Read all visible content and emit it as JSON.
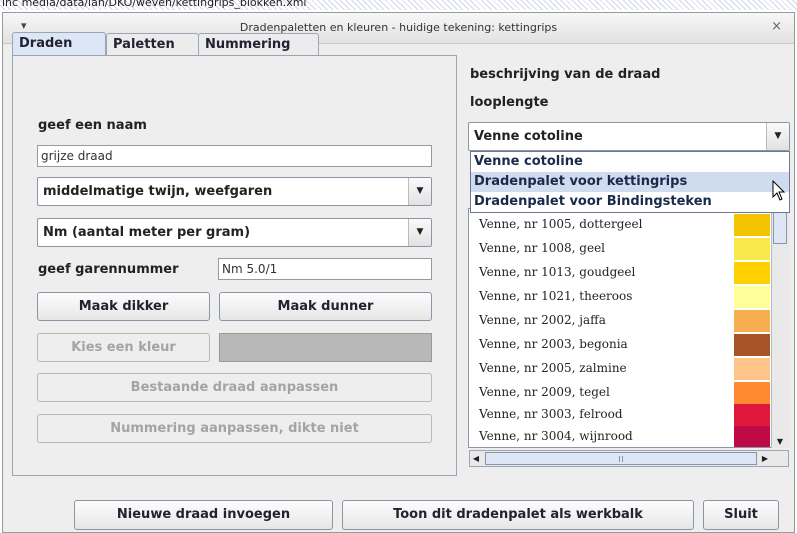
{
  "background_path": "inc   media/data/lan/DKO/weven/kettingrips_blokken.xml",
  "window": {
    "title": "Dradenpaletten en kleuren - huidige tekening: kettingrips",
    "menu_glyph": "▾",
    "close_glyph": "×"
  },
  "tabs": [
    {
      "label": "Draden"
    },
    {
      "label": "Paletten"
    },
    {
      "label": "Nummering"
    }
  ],
  "left": {
    "name_label": "geef een naam",
    "name_value": "grijze draad",
    "type_combo": "middelmatige twijn, weefgaren",
    "unit_combo": "Nm (aantal meter per gram)",
    "count_label": "geef garennummer",
    "count_value": "Nm 5.0/1",
    "thicker_btn": "Maak dikker",
    "thinner_btn": "Maak dunner",
    "color_btn": "Kies een kleur",
    "modify_btn": "Bestaande draad aanpassen",
    "renumber_btn": "Nummering aanpassen, dikte niet"
  },
  "right": {
    "description_label": "beschrijving van de draad",
    "length_label": "looplengte",
    "palette_combo": "Venne cotoline",
    "dropdown_options": [
      {
        "label": "Venne cotoline"
      },
      {
        "label": "Dradenpalet voor kettingrips"
      },
      {
        "label": "Dradenpalet voor Bindingsteken"
      }
    ],
    "yarns": [
      {
        "name": "Venne, nr 1005, dottergeel",
        "color": "#F5C400"
      },
      {
        "name": "Venne, nr 1008, geel",
        "color": "#F8E84A"
      },
      {
        "name": "Venne, nr 1013, goudgeel",
        "color": "#FFD000"
      },
      {
        "name": "Venne, nr 1021, theeroos",
        "color": "#FFFF99"
      },
      {
        "name": "Venne, nr 2002, jaffa",
        "color": "#F7AE50"
      },
      {
        "name": "Venne, nr 2003, begonia",
        "color": "#A65428"
      },
      {
        "name": "Venne, nr 2005, zalmine",
        "color": "#FFC48A"
      },
      {
        "name": "Venne, nr 2009, tegel",
        "color": "#FF8A30"
      },
      {
        "name": "Venne, nr 3003, felrood",
        "color": "#E0183C"
      },
      {
        "name": "Venne, nr 3004, wijnrood",
        "color": "#C00A48"
      }
    ]
  },
  "bottom": {
    "new_btn": "Nieuwe draad invoegen",
    "toolbar_btn": "Toon dit dradenpalet als werkbalk",
    "close_btn": "Sluit"
  }
}
